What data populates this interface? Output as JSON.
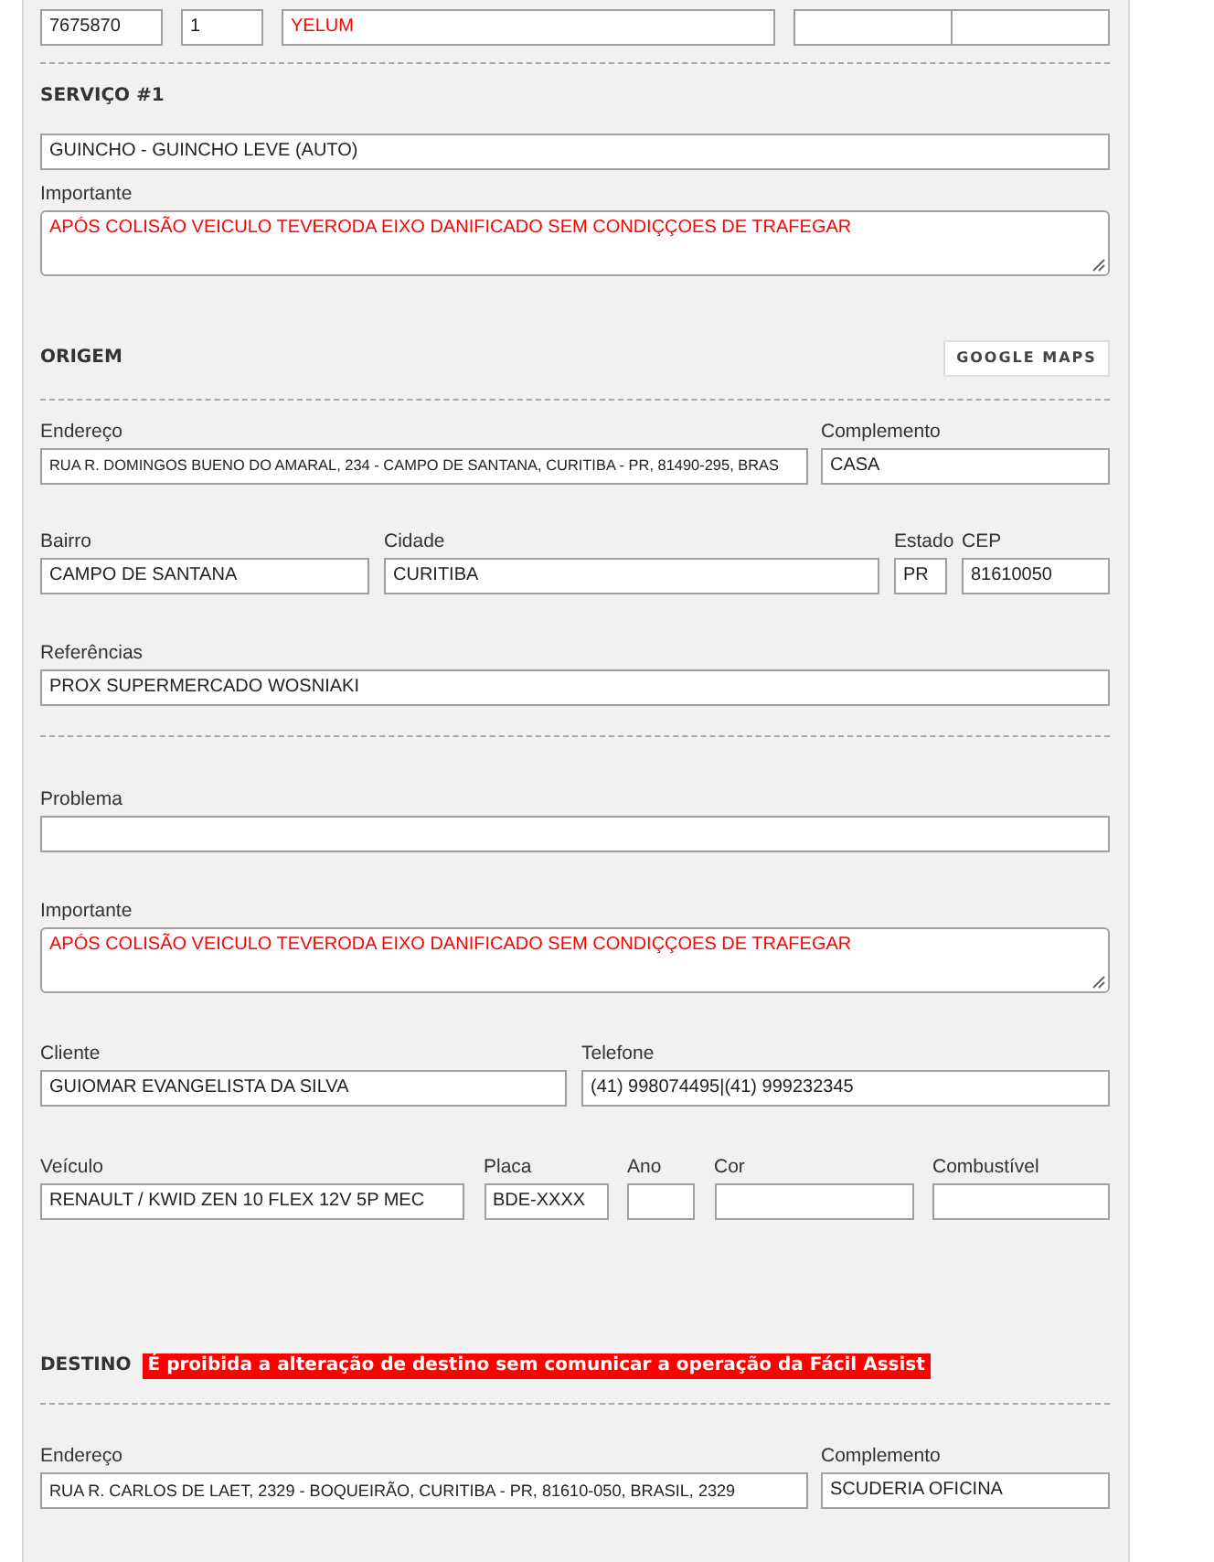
{
  "header_row": [
    {
      "kind": "text",
      "value": "7675870"
    },
    {
      "kind": "text",
      "value": "1"
    },
    {
      "kind": "text",
      "value": "YELUM",
      "alert": true
    },
    {
      "kind": "date"
    }
  ],
  "service": {
    "title": "SERVIÇO #1",
    "type": {
      "kind": "text",
      "value": "GUINCHO - GUINCHO LEVE (AUTO)"
    },
    "important": {
      "kind": "textarea",
      "label": "Importante",
      "value": "APÓS COLISÃO VEICULO TEVERODA EIXO DANIFICADO SEM CONDIÇÇOES DE TRAFEGAR",
      "alert": true
    }
  },
  "origin": {
    "title": "ORIGEM",
    "map_button": "GOOGLE MAPS",
    "address": {
      "kind": "text",
      "label": "Endereço",
      "value": "RUA R. DOMINGOS BUENO DO AMARAL, 234 - CAMPO DE SANTANA, CURITIBA - PR, 81490-295, BRAS"
    },
    "complement": {
      "kind": "text",
      "label": "Complemento",
      "value": "CASA"
    },
    "district": {
      "kind": "text",
      "label": "Bairro",
      "value": "CAMPO DE SANTANA"
    },
    "city": {
      "kind": "text",
      "label": "Cidade",
      "value": "CURITIBA"
    },
    "state": {
      "kind": "text",
      "label": "Estado",
      "value": "PR"
    },
    "zip": {
      "kind": "text",
      "label": "CEP",
      "value": "81610050"
    },
    "references": {
      "kind": "text",
      "label": "Referências",
      "value": "PROX SUPERMERCADO WOSNIAKI"
    }
  },
  "details": {
    "problem": {
      "kind": "text",
      "label": "Problema"
    },
    "important": {
      "kind": "textarea",
      "label": "Importante",
      "value": "APÓS COLISÃO VEICULO TEVERODA EIXO DANIFICADO SEM CONDIÇÇOES DE TRAFEGAR",
      "alert": true
    },
    "client": {
      "kind": "text",
      "label": "Cliente",
      "value": "GUIOMAR EVANGELISTA DA SILVA"
    },
    "phone": {
      "kind": "text",
      "label": "Telefone",
      "value": "(41) 998074495|(41) 999232345"
    },
    "vehicle": {
      "kind": "text",
      "label": "Veículo",
      "value": "RENAULT / KWID ZEN 10 FLEX 12V 5P MEC"
    },
    "plate": {
      "kind": "text",
      "label": "Placa",
      "value": "BDE-XXXX"
    },
    "year": {
      "kind": "text",
      "label": "Ano"
    },
    "color": {
      "kind": "text",
      "label": "Cor"
    },
    "fuel": {
      "kind": "text",
      "label": "Combustível"
    }
  },
  "destination": {
    "title": "DESTINO",
    "warning": "É proibida a alteração de destino sem comunicar a operação da Fácil Assist",
    "address": {
      "kind": "text",
      "label": "Endereço",
      "value": "RUA R. CARLOS DE LAET, 2329 - BOQUEIRÃO, CURITIBA - PR, 81610-050, BRASIL, 2329"
    },
    "complement": {
      "kind": "text",
      "label": "Complemento",
      "value": "SCUDERIA OFICINA"
    }
  }
}
